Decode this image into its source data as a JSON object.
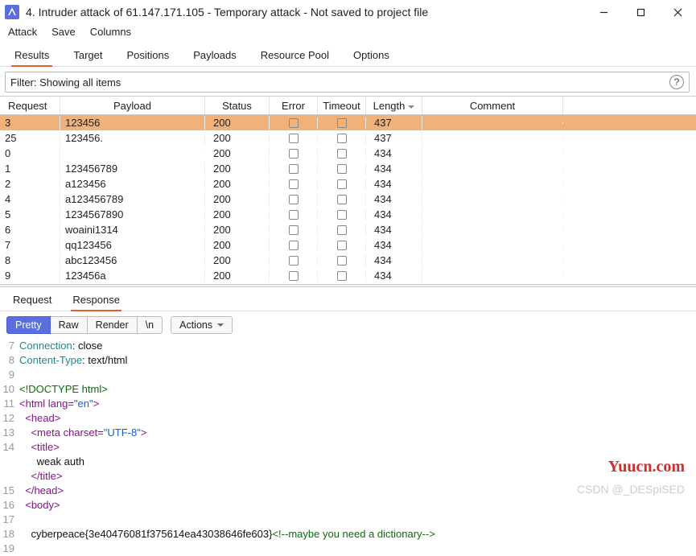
{
  "window": {
    "title": "4. Intruder attack of 61.147.171.105 - Temporary attack - Not saved to project file"
  },
  "menu": {
    "items": [
      "Attack",
      "Save",
      "Columns"
    ]
  },
  "tabs": {
    "items": [
      "Results",
      "Target",
      "Positions",
      "Payloads",
      "Resource Pool",
      "Options"
    ],
    "active": 0
  },
  "filter": {
    "text": "Filter: Showing all items"
  },
  "table": {
    "headers": {
      "request": "Request",
      "payload": "Payload",
      "status": "Status",
      "error": "Error",
      "timeout": "Timeout",
      "length": "Length",
      "comment": "Comment"
    },
    "rows": [
      {
        "request": "3",
        "payload": "123456",
        "status": "200",
        "length": "437",
        "selected": true
      },
      {
        "request": "25",
        "payload": "123456.",
        "status": "200",
        "length": "437"
      },
      {
        "request": "0",
        "payload": "",
        "status": "200",
        "length": "434"
      },
      {
        "request": "1",
        "payload": "123456789",
        "status": "200",
        "length": "434"
      },
      {
        "request": "2",
        "payload": "a123456",
        "status": "200",
        "length": "434"
      },
      {
        "request": "4",
        "payload": "a123456789",
        "status": "200",
        "length": "434"
      },
      {
        "request": "5",
        "payload": "1234567890",
        "status": "200",
        "length": "434"
      },
      {
        "request": "6",
        "payload": "woaini1314",
        "status": "200",
        "length": "434"
      },
      {
        "request": "7",
        "payload": "qq123456",
        "status": "200",
        "length": "434"
      },
      {
        "request": "8",
        "payload": "abc123456",
        "status": "200",
        "length": "434"
      },
      {
        "request": "9",
        "payload": "123456a",
        "status": "200",
        "length": "434"
      }
    ]
  },
  "subtabs": {
    "items": [
      "Request",
      "Response"
    ],
    "active": 1
  },
  "toolbar": {
    "pretty": "Pretty",
    "raw": "Raw",
    "render": "Render",
    "nl": "\\n",
    "actions": "Actions"
  },
  "response": {
    "lines": [
      {
        "n": "7",
        "segments": [
          {
            "t": "Connection",
            "c": "c-key"
          },
          {
            "t": ": close",
            "c": "c-text"
          }
        ]
      },
      {
        "n": "8",
        "segments": [
          {
            "t": "Content-Type",
            "c": "c-key"
          },
          {
            "t": ": text/html",
            "c": "c-text"
          }
        ]
      },
      {
        "n": "9",
        "segments": [
          {
            "t": "",
            "c": "c-text"
          }
        ]
      },
      {
        "n": "10",
        "segments": [
          {
            "t": "<!DOCTYPE html>",
            "c": "c-val"
          }
        ]
      },
      {
        "n": "11",
        "segments": [
          {
            "t": "<html ",
            "c": "c-tag"
          },
          {
            "t": "lang",
            "c": "c-attr"
          },
          {
            "t": "=",
            "c": "c-tag"
          },
          {
            "t": "\"en\"",
            "c": "c-str"
          },
          {
            "t": ">",
            "c": "c-tag"
          }
        ]
      },
      {
        "n": "12",
        "segments": [
          {
            "t": "  ",
            "c": "c-text"
          },
          {
            "t": "<head>",
            "c": "c-tag"
          }
        ]
      },
      {
        "n": "13",
        "segments": [
          {
            "t": "    ",
            "c": "c-text"
          },
          {
            "t": "<meta ",
            "c": "c-tag"
          },
          {
            "t": "charset",
            "c": "c-attr"
          },
          {
            "t": "=",
            "c": "c-tag"
          },
          {
            "t": "\"UTF-8\"",
            "c": "c-str"
          },
          {
            "t": ">",
            "c": "c-tag"
          }
        ]
      },
      {
        "n": "14",
        "segments": [
          {
            "t": "    ",
            "c": "c-text"
          },
          {
            "t": "<title>",
            "c": "c-tag"
          }
        ]
      },
      {
        "n": "",
        "segments": [
          {
            "t": "      weak auth",
            "c": "c-text"
          }
        ]
      },
      {
        "n": "",
        "segments": [
          {
            "t": "    ",
            "c": "c-text"
          },
          {
            "t": "</title>",
            "c": "c-tag"
          }
        ]
      },
      {
        "n": "15",
        "segments": [
          {
            "t": "  ",
            "c": "c-text"
          },
          {
            "t": "</head>",
            "c": "c-tag"
          }
        ]
      },
      {
        "n": "16",
        "segments": [
          {
            "t": "  ",
            "c": "c-text"
          },
          {
            "t": "<body>",
            "c": "c-tag"
          }
        ]
      },
      {
        "n": "17",
        "segments": [
          {
            "t": "",
            "c": "c-text"
          }
        ]
      },
      {
        "n": "18",
        "segments": [
          {
            "t": "    cyberpeace{3e40476081f375614ea43038646fe603}",
            "c": "c-text"
          },
          {
            "t": "<!--maybe you need a dictionary-->",
            "c": "c-comment"
          }
        ]
      },
      {
        "n": "19",
        "segments": [
          {
            "t": "",
            "c": "c-text"
          }
        ]
      }
    ]
  },
  "watermarks": {
    "site": "Yuucn.com",
    "csdn": "CSDN @_DESpiSED"
  }
}
